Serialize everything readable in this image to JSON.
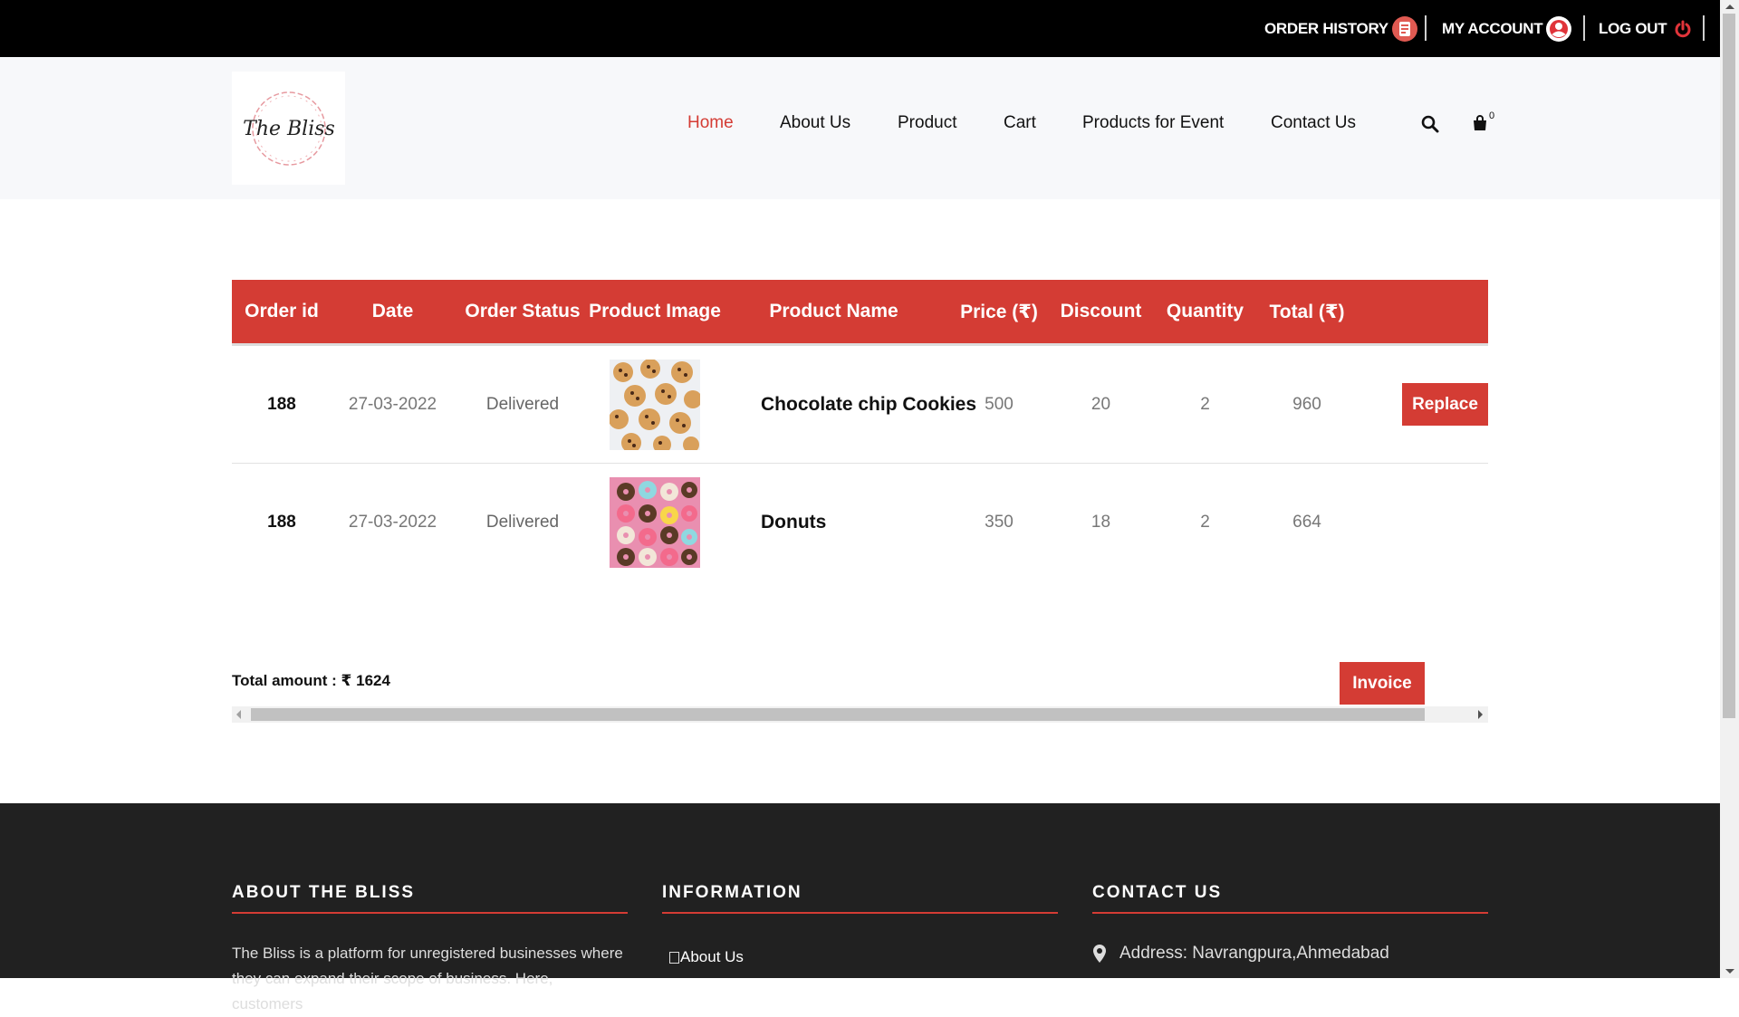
{
  "topbar": {
    "order_history": "ORDER HISTORY",
    "my_account": "MY ACCOUNT",
    "log_out": "LOG OUT"
  },
  "header": {
    "logo_text": "The Bliss",
    "nav": [
      "Home",
      "About Us",
      "Product",
      "Cart",
      "Products for Event",
      "Contact Us"
    ],
    "active_nav": "Home",
    "cart_count": "0"
  },
  "table": {
    "headers": [
      "Order id",
      "Date",
      "Order Status",
      "Product Image",
      "Product Name",
      "Price (₹)",
      "Discount",
      "Quantity",
      "Total (₹)"
    ],
    "rows": [
      {
        "order_id": "188",
        "date": "27-03-2022",
        "status": "Delivered",
        "image": "cookies-image",
        "name": "Chocolate chip Cookies",
        "price": "500",
        "discount": "20",
        "quantity": "2",
        "total": "960",
        "action": "Replace"
      },
      {
        "order_id": "188",
        "date": "27-03-2022",
        "status": "Delivered",
        "image": "donuts-image",
        "name": "Donuts",
        "price": "350",
        "discount": "18",
        "quantity": "2",
        "total": "664",
        "action": ""
      }
    ]
  },
  "summary": {
    "total_label": "Total amount : ₹ 1624",
    "invoice_label": "Invoice"
  },
  "footer": {
    "about": {
      "title": "ABOUT THE BLISS",
      "text": "The Bliss is a platform for unregistered businesses where they can expand their scope of business. Here, customers"
    },
    "information": {
      "title": "INFORMATION",
      "link": "About Us"
    },
    "contact": {
      "title": "CONTACT US",
      "address": "Address: Navrangpura,Ahmedabad"
    }
  },
  "colors": {
    "accent": "#d43c34",
    "topbar": "#000000",
    "footer": "#212121"
  }
}
